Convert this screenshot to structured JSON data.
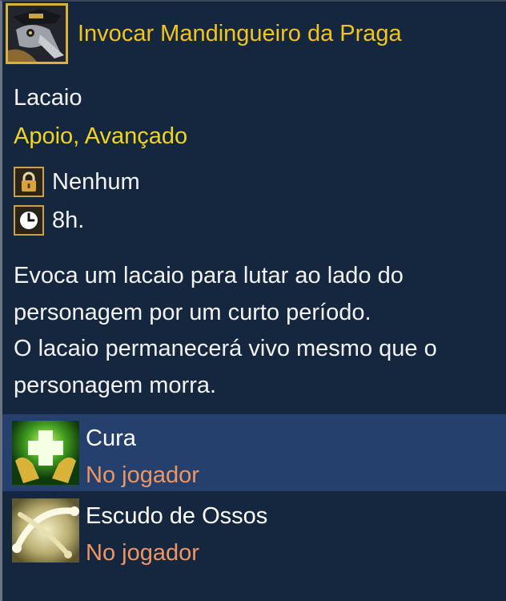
{
  "skill": {
    "title": "Invocar Mandingueiro da Praga",
    "icon": "plague-doctor-mask-icon"
  },
  "kind": "Lacaio",
  "tags": "Apoio, Avançado",
  "stats": {
    "cost": {
      "icon": "padlock-icon",
      "label": "Nenhum"
    },
    "cooldown": {
      "icon": "clock-icon",
      "label": "8h."
    }
  },
  "description": [
    "Evoca um lacaio para lutar ao lado do",
    "personagem por um curto período.",
    "O lacaio permanecerá vivo mesmo que o",
    "personagem morra."
  ],
  "effects": [
    {
      "name": "Cura",
      "target": "No jogador",
      "icon": "heal-hands-icon",
      "selected": true
    },
    {
      "name": "Escudo de Ossos",
      "target": "No jogador",
      "icon": "bone-shield-icon",
      "selected": false
    }
  ],
  "colors": {
    "background": "#15263f",
    "title": "#f3c51b",
    "tags": "#f1d51a",
    "target": "#ee9564",
    "selected_row": "#26406d"
  }
}
